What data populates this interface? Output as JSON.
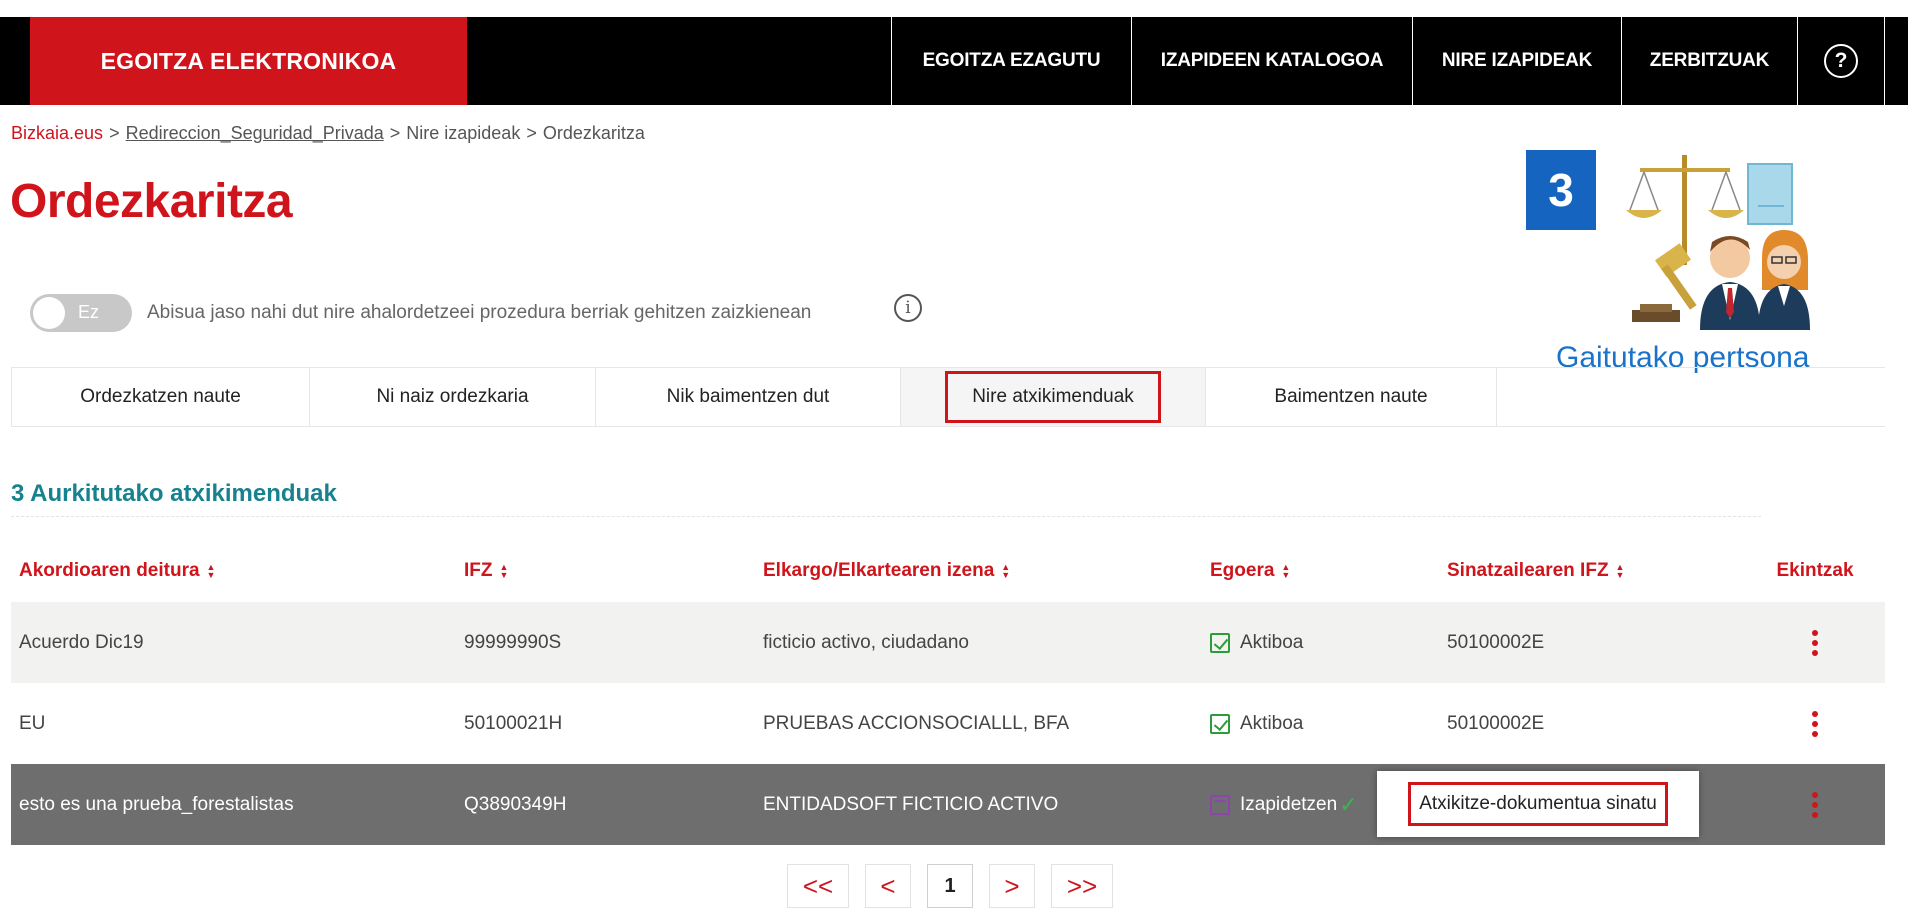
{
  "header": {
    "brand": "EGOITZA ELEKTRONIKOA",
    "nav": [
      {
        "label": "EGOITZA EZAGUTU"
      },
      {
        "label": "IZAPIDEEN KATALOGOA"
      },
      {
        "label": "NIRE IZAPIDEAK"
      },
      {
        "label": "ZERBITZUAK"
      }
    ],
    "help_symbol": "?"
  },
  "breadcrumb": {
    "home": "Bizkaia.eus",
    "sep": ">",
    "link": "Redireccion_Seguridad_Privada",
    "crumb3": "Nire izapideak",
    "crumb4": "Ordezkaritza"
  },
  "page_title": "Ordezkaritza",
  "notification": {
    "toggle_label": "Ez",
    "text": "Abisua jaso nahi dut nire ahalordetzeei prozedura berriak gehitzen zaizkienean",
    "info_symbol": "i"
  },
  "illustration": {
    "badge": "3",
    "caption": "Gaitutako pertsona"
  },
  "tabs": [
    {
      "label": "Ordezkatzen naute"
    },
    {
      "label": "Ni naiz ordezkaria"
    },
    {
      "label": "Nik baimentzen dut"
    },
    {
      "label": "Nire atxikimenduak"
    },
    {
      "label": "Baimentzen naute"
    }
  ],
  "results": {
    "title": "3 Aurkitutako atxikimenduak"
  },
  "table": {
    "headers": [
      "Akordioaren deitura",
      "IFZ",
      "Elkargo/Elkartearen izena",
      "Egoera",
      "Sinatzailearen IFZ",
      "Ekintzak"
    ],
    "rows": [
      {
        "name": "Acuerdo Dic19",
        "ifz": "99999990S",
        "org": "ficticio activo, ciudadano",
        "status": "Aktiboa",
        "signer": "50100002E"
      },
      {
        "name": "EU",
        "ifz": "50100021H",
        "org": "PRUEBAS ACCIONSOCIALLL, BFA",
        "status": "Aktiboa",
        "signer": "50100002E"
      },
      {
        "name": "esto es una prueba_forestalistas",
        "ifz": "Q3890349H",
        "org": "ENTIDADSOFT FICTICIO ACTIVO",
        "status": "Izapidetzen",
        "signer": ""
      }
    ],
    "popover": "Atxikitze-dokumentua sinatu"
  },
  "pagination": {
    "first": "<<",
    "prev": "<",
    "current": "1",
    "next": ">",
    "last": ">>"
  },
  "colors": {
    "brand_red": "#d0141c",
    "teal": "#17818e",
    "blue": "#1565c0",
    "status_green": "#2e9b3a"
  }
}
